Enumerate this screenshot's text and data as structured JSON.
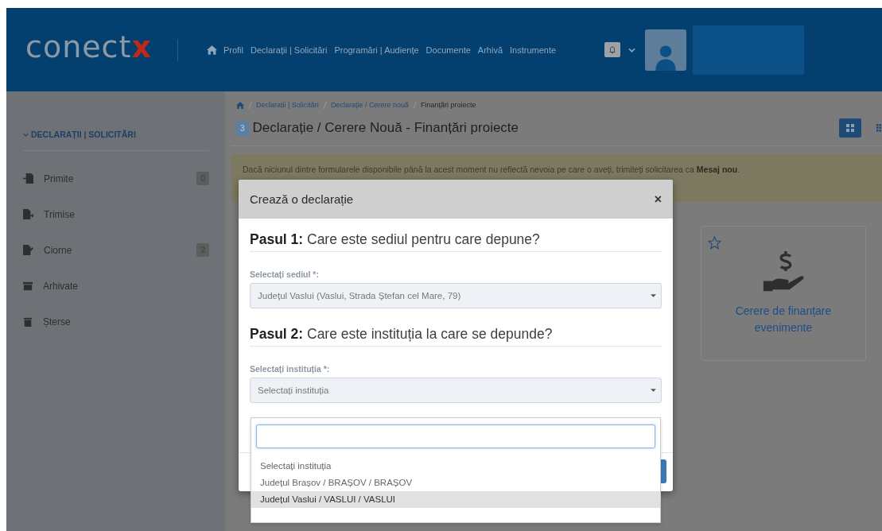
{
  "header": {
    "logo": "conect",
    "logo_accent": "x",
    "nav": [
      "Profil",
      "Declarații | Solicitări",
      "Programări | Audiențe",
      "Documente",
      "Arhivă",
      "Instrumente"
    ]
  },
  "sidebar": {
    "title": "DECLARAȚII | SOLICITĂRI",
    "expanded": true,
    "items": [
      {
        "label": "Primite",
        "count": "0"
      },
      {
        "label": "Trimise"
      },
      {
        "label": "Ciorne",
        "count": "2"
      },
      {
        "label": "Arhivate"
      },
      {
        "label": "Șterse"
      }
    ]
  },
  "breadcrumb": [
    "Declarații | Solicitări",
    "Declarație / Cerere nouă",
    "Finanțări proiecte"
  ],
  "page_title": {
    "badge": "3",
    "text": "Declarație / Cerere Nouă - Finanțări proiecte"
  },
  "view_buttons": [
    {
      "selected": true
    },
    {
      "selected": false
    }
  ],
  "notice": "Dacă niciunul dintre formularele disponibile până la acest moment nu reflectă nevoia pe care o aveți, trimiteți solicitarea ca **Mesaj nou**.",
  "cards": [
    {
      "title": "Cerere de finanțare evenimente",
      "favorite": false
    }
  ],
  "modal": {
    "title": "Crează o declarație",
    "close": "×",
    "steps": [
      {
        "label": "Pasul 1:",
        "question": "Care este sediul pentru care depune?",
        "field_label": "Selectați sediul *:",
        "value": "Județul Vaslui (Vaslui, Strada Ștefan cel Mare, 79)"
      },
      {
        "label": "Pasul 2:",
        "question": "Care este instituția la care se depunde?",
        "field_label": "Selectați instituția *:",
        "placeholder": "Selectați instituția"
      }
    ],
    "dropdown": {
      "options": [
        {
          "label": "Selectați instituția",
          "selected": false
        },
        {
          "label": "Județul Brașov / BRAȘOV / BRAȘOV",
          "selected": false
        },
        {
          "label": "Județul Vaslui / VASLUI / VASLUI",
          "selected": true
        }
      ]
    }
  }
}
